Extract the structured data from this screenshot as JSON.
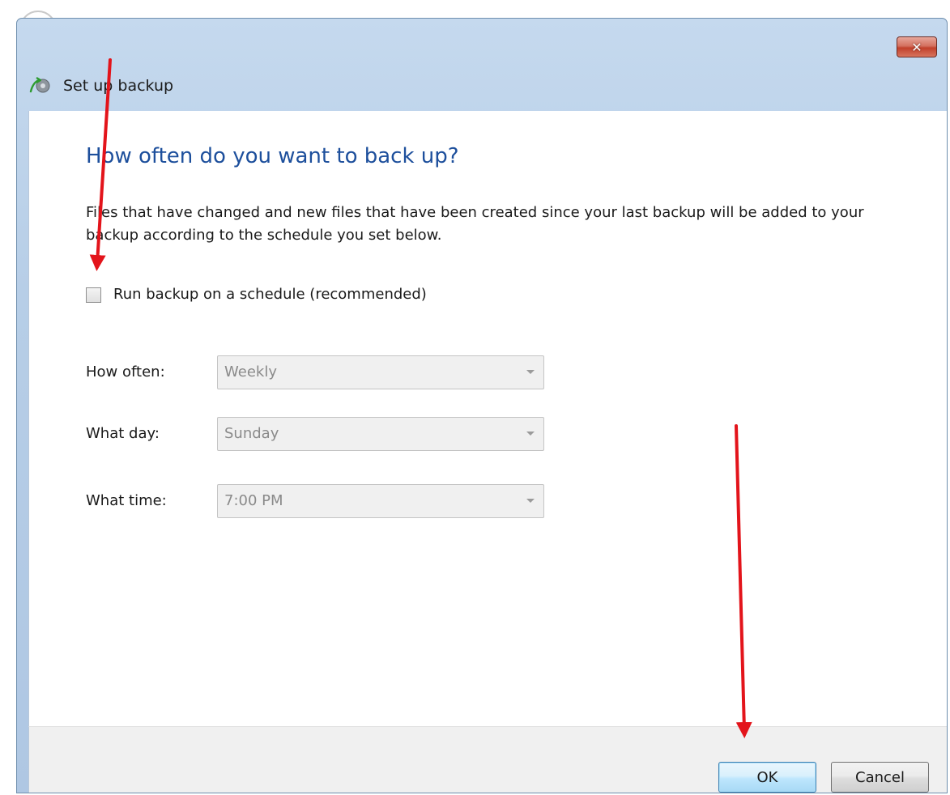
{
  "window": {
    "title": "Set up backup",
    "close_label": "✕"
  },
  "content": {
    "heading": "How often do you want to back up?",
    "description": "Files that have changed and new files that have been created since your last backup will be added to your backup according to the schedule you set below.",
    "schedule_checkbox_label": "Run backup on a schedule (recommended)",
    "schedule_checked": false,
    "how_often_label": "How often:",
    "how_often_value": "Weekly",
    "what_day_label": "What day:",
    "what_day_value": "Sunday",
    "what_time_label": "What time:",
    "what_time_value": "7:00 PM"
  },
  "footer": {
    "ok_label": "OK",
    "cancel_label": "Cancel"
  },
  "colors": {
    "heading": "#1d4f9c",
    "title_bar": "#b7cee7",
    "annotation_arrow": "#e3141b"
  },
  "icons": {
    "app_icon": "backup-icon",
    "close_icon": "close-icon",
    "dropdown_icon": "chevron-down-icon"
  }
}
